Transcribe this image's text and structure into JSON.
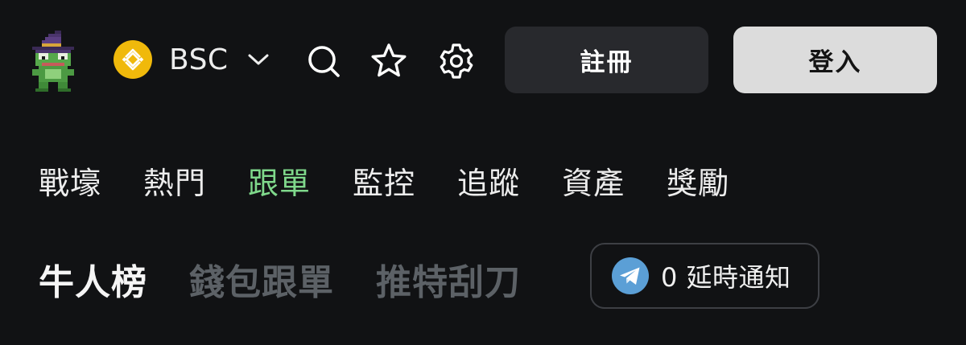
{
  "header": {
    "chain": {
      "label": "BSC",
      "coin_icon": "bnb-coin-icon",
      "dropdown_icon": "chevron-down-icon"
    },
    "icons": [
      "search-icon",
      "star-icon",
      "gear-icon"
    ],
    "register_label": "註冊",
    "login_label": "登入"
  },
  "nav": {
    "tabs": [
      {
        "label": "戰壕"
      },
      {
        "label": "熱門"
      },
      {
        "label": "跟單",
        "active": true
      },
      {
        "label": "監控"
      },
      {
        "label": "追蹤"
      },
      {
        "label": "資產"
      },
      {
        "label": "獎勵"
      }
    ]
  },
  "subnav": {
    "tabs": [
      {
        "label": "牛人榜",
        "active": true
      },
      {
        "label": "錢包跟單"
      },
      {
        "label": "推特刮刀"
      }
    ],
    "notify": {
      "icon": "telegram-icon",
      "label": "0 延時通知"
    }
  },
  "colors": {
    "background": "#111214",
    "active_tab": "#7fd88b",
    "inactive_subtab": "#5c6166",
    "register_bg": "#28292d",
    "login_bg": "#dcdcdc",
    "coin": "#f0b90b",
    "telegram": "#5b9fd6"
  }
}
